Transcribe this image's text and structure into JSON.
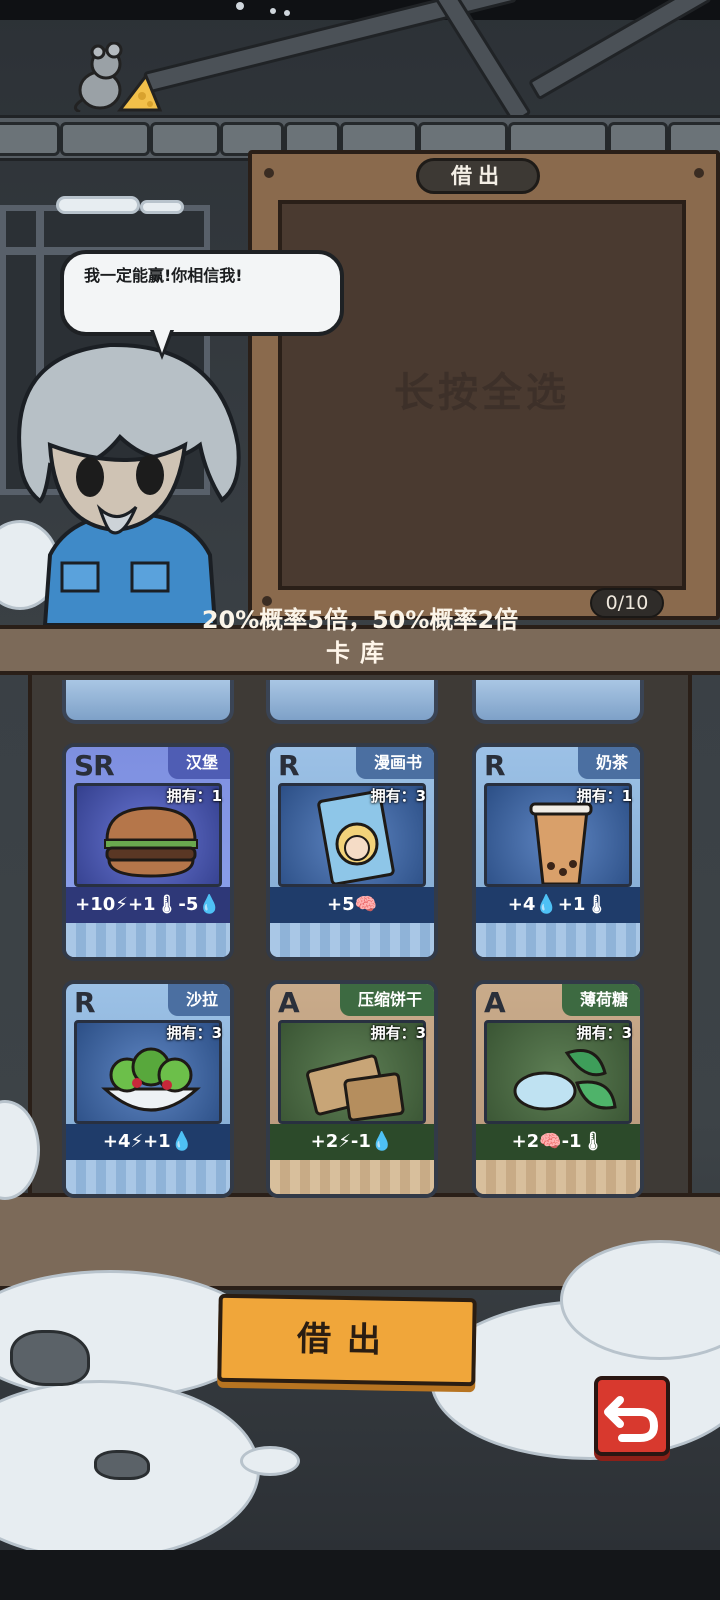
{
  "board": {
    "title": "借出",
    "hint": "长按全选",
    "counter": "0/10"
  },
  "speech": {
    "text": "我一定能赢!你相信我!"
  },
  "library": {
    "title": "卡库",
    "odds_text": "20%概率5倍，50%概率2倍"
  },
  "cards": [
    {
      "rarity": "SR",
      "name": "汉堡",
      "owned": "拥有：1",
      "stats": "+10⚡+1🌡-5💧"
    },
    {
      "rarity": "R",
      "name": "漫画书",
      "owned": "拥有：3",
      "stats": "+5🧠"
    },
    {
      "rarity": "R",
      "name": "奶茶",
      "owned": "拥有：1",
      "stats": "+4💧+1🌡"
    },
    {
      "rarity": "R",
      "name": "沙拉",
      "owned": "拥有：3",
      "stats": "+4⚡+1💧"
    },
    {
      "rarity": "A",
      "name": "压缩饼干",
      "owned": "拥有：3",
      "stats": "+2⚡-1💧"
    },
    {
      "rarity": "A",
      "name": "薄荷糖",
      "owned": "拥有：3",
      "stats": "+2🧠-1🌡"
    }
  ],
  "buttons": {
    "lend_label": "借出"
  },
  "icons": {
    "back": "undo-arrow-icon",
    "energy": "lightning-icon",
    "warmth": "thermometer-icon",
    "water": "water-drop-icon",
    "mind": "brain-icon"
  },
  "colors": {
    "lend_button": "#f0a63a",
    "back_button": "#d8392e",
    "rarity_sr": "#4f5db4",
    "rarity_r": "#4b6fa1",
    "rarity_a": "#3d6a41"
  }
}
